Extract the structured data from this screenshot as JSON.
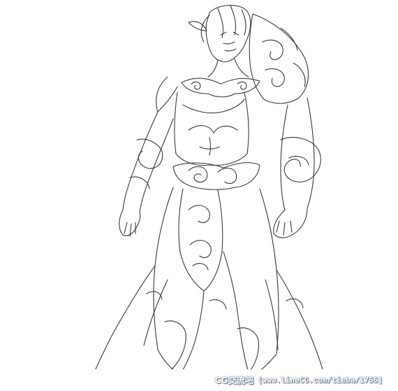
{
  "image": {
    "subject": "line-art character sketch",
    "background_color": "#ffffff",
    "line_color": "#3a3a3a"
  },
  "watermark": {
    "site_name": "CG交流吧",
    "url": "[www.lineCG.com/tieba/1755]"
  }
}
